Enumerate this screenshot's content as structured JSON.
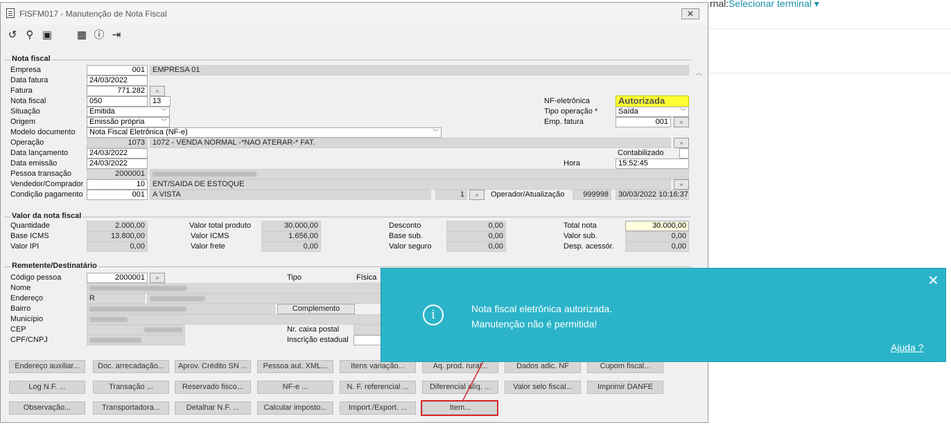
{
  "background": {
    "label": "rnal:",
    "select": "Selecionar terminal"
  },
  "window": {
    "title": "FISFM017 - Manutenção de Nota Fiscal"
  },
  "nf": {
    "section": "Nota fiscal",
    "empresa_label": "Empresa",
    "empresa_code": "001",
    "empresa_name": "EMPRESA 01",
    "data_fatura_label": "Data fatura",
    "data_fatura": "24/03/2022",
    "fatura_label": "Fatura",
    "fatura": "771.282",
    "nota_label": "Nota fiscal",
    "nota_serie": "050",
    "nota_num": "13",
    "situacao_label": "Situação",
    "situacao": "Emitida",
    "origem_label": "Origem",
    "origem": "Emissão própria",
    "modelo_label": "Modelo documento",
    "modelo": "Nota Fiscal Eletrônica (NF-e)",
    "operacao_label": "Operação",
    "operacao_code": "1073",
    "operacao_desc": "1072 - VENDA NORMAL  -*NAO ATERAR-* FAT.",
    "data_lanc_label": "Data lançamento",
    "data_lanc": "24/03/2022",
    "data_emis_label": "Data emissão",
    "data_emis": "24/03/2022",
    "pessoa_label": "Pessoa transação",
    "pessoa_code": "2000001",
    "vendedor_label": "Vendedor/Comprador",
    "vendedor_code": "10",
    "vendedor_desc": "ENT/SAIDA DE ESTOQUE",
    "cond_label": "Condição pagamento",
    "cond_code": "001",
    "cond_desc": "A VISTA",
    "cond_num": "1",
    "operador_label": "Operador/Atualização",
    "operador": "999998",
    "atualizacao": "30/03/2022 10:16:37",
    "nfe_label": "NF-eletrônica",
    "nfe_status": "Autorizada",
    "tipo_op_label": "Tipo operação *",
    "tipo_op": "Saída",
    "emp_fat_label": "Emp. fatura",
    "emp_fat": "001",
    "contab_label": "Contabilizado",
    "hora_label": "Hora",
    "hora": "15:52:45"
  },
  "valor": {
    "section": "Valor da nota fiscal",
    "qtd_label": "Quantidade",
    "qtd": "2.000,00",
    "base_icms_label": "Base ICMS",
    "base_icms": "13.800,00",
    "ipi_label": "Valor IPI",
    "ipi": "0,00",
    "vtp_label": "Valor total produto",
    "vtp": "30.000,00",
    "vicms_label": "Valor ICMS",
    "vicms": "1.656,00",
    "frete_label": "Valor frete",
    "frete": "0,00",
    "desc_label": "Desconto",
    "desc": "0,00",
    "bsub_label": "Base sub.",
    "bsub": "0,00",
    "seguro_label": "Valor seguro",
    "seguro": "0,00",
    "total_label": "Total nota",
    "total": "30.000,00",
    "vsub_label": "Valor sub.",
    "vsub": "0,00",
    "desp_label": "Desp. acessór.",
    "desp": "0,00"
  },
  "rem": {
    "section": "Remetente/Destinatário",
    "cod_label": "Código pessoa",
    "cod": "2000001",
    "nome_label": "Nome",
    "end_label": "Endereço",
    "end_tipo": "R",
    "bairro_label": "Bairro",
    "complemento": "Complemento",
    "mun_label": "Município",
    "cep_label": "CEP",
    "cpf_label": "CPF/CNPJ",
    "tipo_label": "Tipo",
    "tipo": "Física",
    "caixa_label": "Nr. caixa postal",
    "ie_label": "Inscrição estadual"
  },
  "buttons": {
    "r1": [
      "Endereço auxiliar...",
      "Doc. arrecadação...",
      "Aprov. Crédito SN ...",
      "Pessoa aut. XML...",
      "Itens variação...",
      "Aq. prod. rural...",
      "Dados adic. NF",
      "Cupom fiscal..."
    ],
    "r2": [
      "Log N.F. ...",
      "Transação ...",
      "Reservado fisco...",
      "NF-e ...",
      "N. F. referencial ...",
      "Diferencial alíq. ...",
      "Valor selo fiscal...",
      "Imprimir DANFE"
    ],
    "r3": [
      "Observação...",
      "Transportadora...",
      "Detalhar N.F. ...",
      "Calcular imposto...",
      "Import./Export. ...",
      "Item..."
    ]
  },
  "toast": {
    "line1": "Nota fiscal eletrônica autorizada.",
    "line2": "Manutenção não é permitida!",
    "help": "Ajuda ?",
    "close": "✕"
  }
}
